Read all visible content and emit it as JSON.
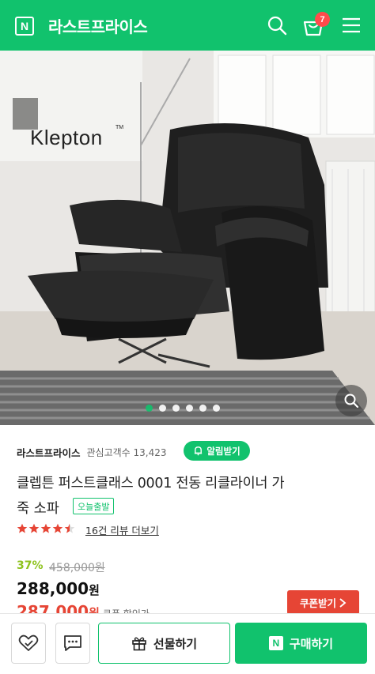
{
  "header": {
    "logo_letter": "N",
    "store_name": "라스트프라이스",
    "cart_count": "7",
    "icons": [
      "search-icon",
      "cart-icon",
      "menu-icon"
    ]
  },
  "hero": {
    "brand_logo": "Klepton",
    "brand_tm": "TM",
    "slide_count": 6,
    "active_slide": 1
  },
  "seller": {
    "name": "라스트프라이스",
    "followers_label": "관심고객수 13,423",
    "alarm_button": "알림받기"
  },
  "product": {
    "title_line1": "클렙튼 퍼스트클래스 0001 전동 리클라이너 가",
    "title_line2": "죽 소파",
    "badge": "오늘출발",
    "rating": 4.5,
    "review_link": "16건 리뷰 더보기"
  },
  "price": {
    "discount": "37%",
    "original": "458,000원",
    "sale": "288,000",
    "won": "원",
    "coupon_price": "287,000",
    "coupon_label": "쿠폰 할인가",
    "coupon_button": "쿠폰받기"
  },
  "bottom": {
    "gift_label": "선물하기",
    "buy_label": "구매하기",
    "buy_logo": "N"
  },
  "colors": {
    "brand_green": "#11c26d",
    "coupon_red": "#e64535",
    "star_red": "#e64535"
  }
}
